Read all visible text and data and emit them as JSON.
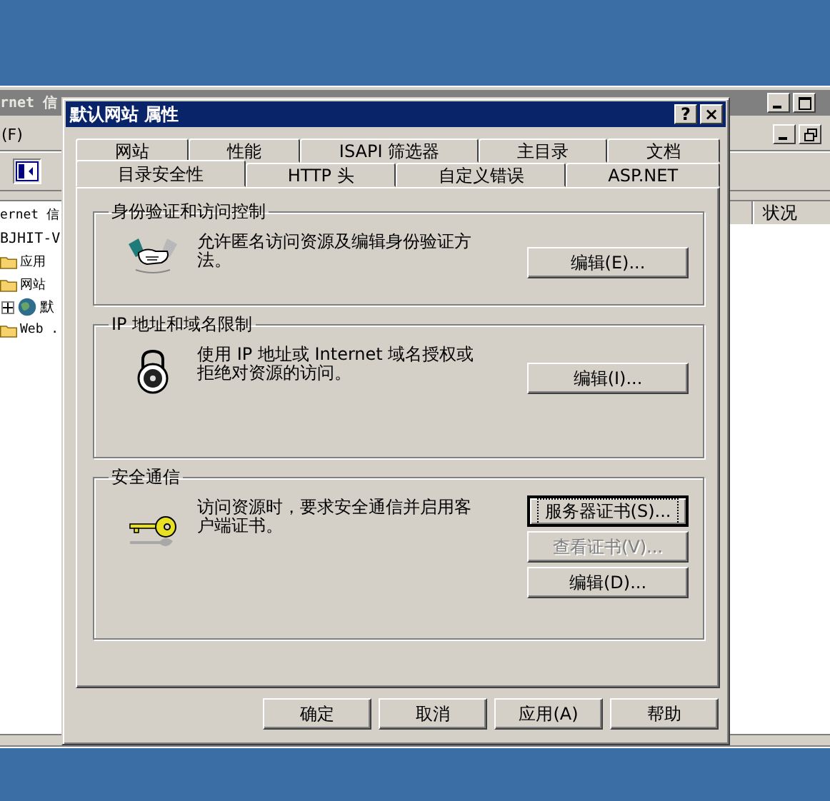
{
  "background_window": {
    "title": "rnet 信",
    "menu": [
      "(F)"
    ],
    "tree_header": "ernet 信",
    "tree": [
      {
        "label": "BJHIT-V",
        "children": [
          {
            "label": "应用",
            "kind": "folder"
          },
          {
            "label": "网站",
            "kind": "folder",
            "children": [
              {
                "label": "默",
                "kind": "site",
                "expanded": false
              }
            ]
          },
          {
            "label": "Web .",
            "kind": "folder"
          }
        ]
      }
    ],
    "columns": [
      "状况"
    ]
  },
  "dialog": {
    "title": "默认网站 属性",
    "help_button": "?",
    "close_button": "×",
    "tab_rows": [
      [
        {
          "label": "网站",
          "selected": false
        },
        {
          "label": "性能",
          "selected": false
        },
        {
          "label": "ISAPI 筛选器",
          "selected": false
        },
        {
          "label": "主目录",
          "selected": false
        },
        {
          "label": "文档",
          "selected": false
        }
      ],
      [
        {
          "label": "目录安全性",
          "selected": true
        },
        {
          "label": "HTTP 头",
          "selected": false
        },
        {
          "label": "自定义错误",
          "selected": false
        },
        {
          "label": "ASP.NET",
          "selected": false
        }
      ]
    ],
    "groups": [
      {
        "title": "身份验证和访问控制",
        "kind": "handshake",
        "description": "允许匿名访问资源及编辑身份验证方法。",
        "buttons": [
          {
            "label": "编辑(E)...",
            "disabled": false,
            "focused": false
          }
        ]
      },
      {
        "title": "IP 地址和域名限制",
        "kind": "lock",
        "description": "使用 IP 地址或 Internet 域名授权或拒绝对资源的访问。",
        "buttons": [
          {
            "label": "编辑(I)...",
            "disabled": false,
            "focused": false
          }
        ]
      },
      {
        "title": "安全通信",
        "kind": "key",
        "description": "访问资源时，要求安全通信并启用客户端证书。",
        "buttons": [
          {
            "label": "服务器证书(S)...",
            "disabled": false,
            "focused": true
          },
          {
            "label": "查看证书(V)...",
            "disabled": true,
            "focused": false
          },
          {
            "label": "编辑(D)...",
            "disabled": false,
            "focused": false
          }
        ]
      }
    ],
    "buttons": [
      "确定",
      "取消",
      "应用(A)",
      "帮助"
    ]
  }
}
